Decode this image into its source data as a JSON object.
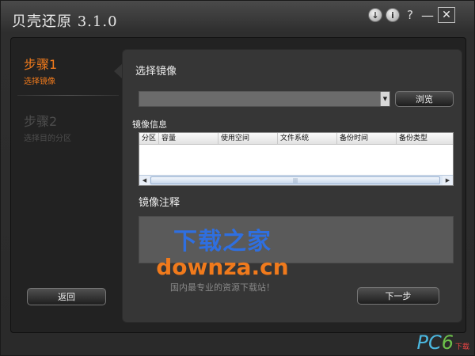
{
  "window": {
    "title": "贝壳还原 3.1.0"
  },
  "titlebar": {
    "update_glyph": "↓",
    "info_glyph": "i",
    "help_glyph": "?",
    "min_glyph": "—",
    "close_glyph": "✕"
  },
  "sidebar": {
    "steps": [
      {
        "title": "步骤1",
        "subtitle": "选择镜像"
      },
      {
        "title": "步骤2",
        "subtitle": "选择目的分区"
      }
    ],
    "back_label": "返回"
  },
  "panel": {
    "select_title": "选择镜像",
    "combo_value": "",
    "browse_label": "浏览",
    "info_title": "镜像信息",
    "columns": [
      "分区",
      "容量",
      "使用空间",
      "文件系统",
      "备份时间",
      "备份类型"
    ],
    "note_title": "镜像注释",
    "note_value": "",
    "next_label": "下一步"
  },
  "watermark": {
    "cn": "下载之家",
    "en": "downza.cn",
    "tagline": "国内最专业的资源下载站！"
  },
  "corner_logo": {
    "pc": "PC",
    "six": "6",
    "sub": "下载"
  },
  "colors": {
    "accent": "#f07a1c",
    "watermark_blue": "#2f6fe0"
  }
}
